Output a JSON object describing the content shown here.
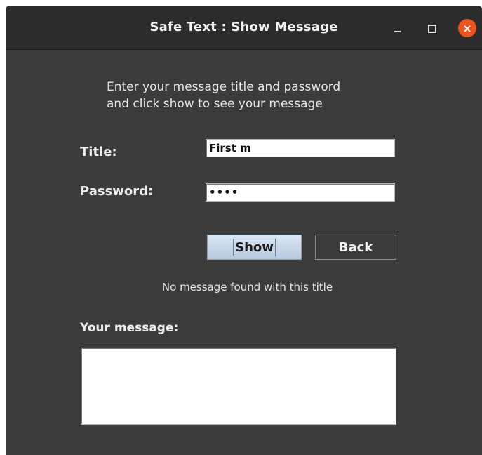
{
  "window": {
    "title": "Safe Text : Show Message",
    "close_glyph": "×",
    "icons": [
      "minimize-icon",
      "maximize-icon",
      "close-icon"
    ]
  },
  "instructions": {
    "line1": "Enter your message title and password",
    "line2": "and click show to see your message"
  },
  "form": {
    "title_label": "Title:",
    "title_value": "First m",
    "password_label": "Password:",
    "password_value": "••••"
  },
  "buttons": {
    "show_label": "Show",
    "back_label": "Back"
  },
  "status": {
    "text": "No message found with this title"
  },
  "message": {
    "label": "Your message:",
    "value": ""
  },
  "colors": {
    "background": "#3b3b3b",
    "titlebar": "#2c2c2c",
    "close_button": "#e95420",
    "show_button": "#c6d6e8"
  }
}
